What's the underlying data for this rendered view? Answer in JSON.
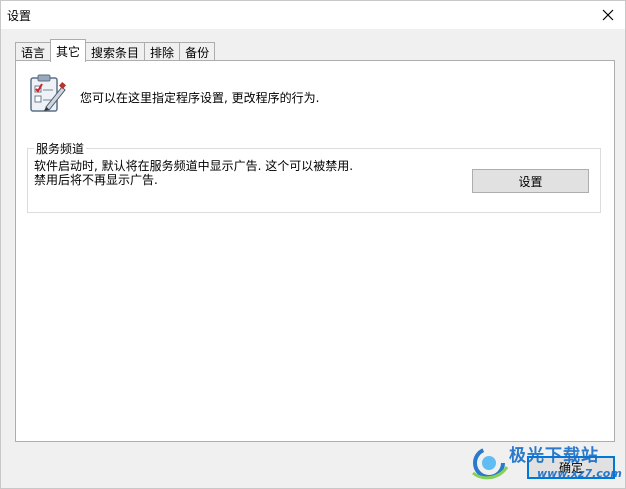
{
  "window": {
    "title": "设置",
    "close_glyph": "✕"
  },
  "tabs": [
    {
      "label": "语言",
      "active": false
    },
    {
      "label": "其它",
      "active": true
    },
    {
      "label": "搜索条目",
      "active": false
    },
    {
      "label": "排除",
      "active": false
    },
    {
      "label": "备份",
      "active": false
    }
  ],
  "panel": {
    "intro": "您可以在这里指定程序设置, 更改程序的行为.",
    "group": {
      "title": "服务频道",
      "desc_line1": "软件启动时, 默认将在服务频道中显示广告. 这个可以被禁用.",
      "desc_line2": "禁用后将不再显示广告.",
      "button_label": "设置"
    }
  },
  "footer": {
    "ok_label": "确定"
  },
  "watermark": {
    "brand": "极光下载站",
    "url": "www.xz7.com"
  },
  "colors": {
    "accent": "#0078d7",
    "watermark": "#1a6fc9"
  },
  "icons": {
    "header": "clipboard-checklist-icon",
    "close": "close-icon"
  }
}
